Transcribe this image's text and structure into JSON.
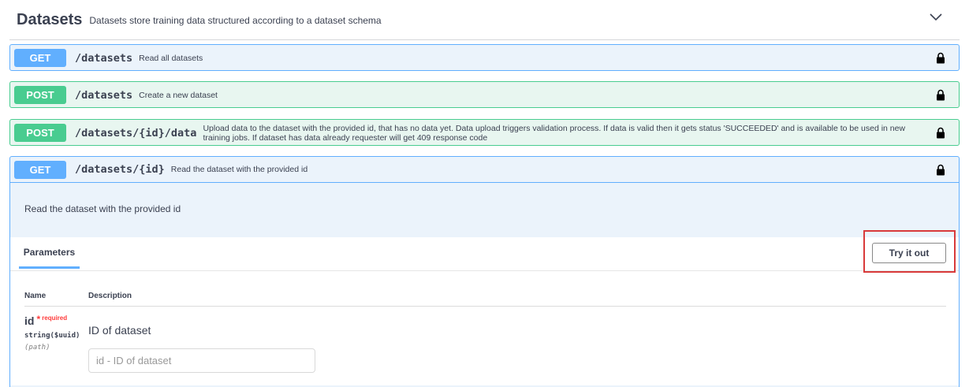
{
  "tag": {
    "title": "Datasets",
    "description": "Datasets store training data structured according to a dataset schema",
    "chevron_icon": "chevron-down-icon"
  },
  "colors": {
    "get": "#61affe",
    "post": "#49cc90",
    "highlight": "#d93a3a"
  },
  "operations": [
    {
      "method": "GET",
      "path": "/datasets",
      "summary": "Read all datasets",
      "icon": "lock-icon"
    },
    {
      "method": "POST",
      "path": "/datasets",
      "summary": "Create a new dataset",
      "icon": "lock-icon"
    },
    {
      "method": "POST",
      "path": "/datasets/{id}/data",
      "summary": "Upload data to the dataset with the provided id, that has no data yet. Data upload triggers validation process. If data is valid then it gets status 'SUCCEEDED' and is available to be used in new training jobs. If dataset has data already requester will get 409 response code",
      "icon": "lock-icon"
    },
    {
      "method": "GET",
      "path": "/datasets/{id}",
      "summary": "Read the dataset with the provided id",
      "icon": "lock-icon"
    }
  ],
  "expanded": {
    "description": "Read the dataset with the provided id",
    "parameters_tab": "Parameters",
    "try_it_out": "Try it out",
    "columns": {
      "name": "Name",
      "description": "Description"
    },
    "param": {
      "name": "id",
      "star": "*",
      "required": "required",
      "type": "string($uuid)",
      "in": "(path)",
      "description": "ID of dataset",
      "placeholder": "id - ID of dataset",
      "value": ""
    }
  }
}
